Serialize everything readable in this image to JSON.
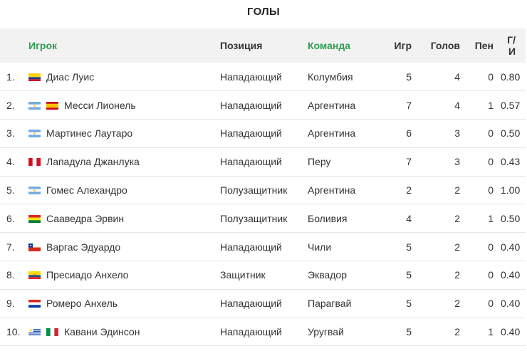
{
  "title": "ГОЛЫ",
  "headers": {
    "player": "Игрок",
    "position": "Позиция",
    "team": "Команда",
    "games": "Игр",
    "goals": "Голов",
    "penalties": "Пен",
    "ratio": "Г/И"
  },
  "rows": [
    {
      "rank": "1.",
      "flags": [
        "colombia-flag-icon"
      ],
      "player": "Диас Луис",
      "position": "Нападающий",
      "team": "Колумбия",
      "games": "5",
      "goals": "4",
      "penalties": "0",
      "ratio": "0.80"
    },
    {
      "rank": "2.",
      "flags": [
        "argentina-flag-icon",
        "spain-flag-icon"
      ],
      "player": "Месси Лионель",
      "position": "Нападающий",
      "team": "Аргентина",
      "games": "7",
      "goals": "4",
      "penalties": "1",
      "ratio": "0.57"
    },
    {
      "rank": "3.",
      "flags": [
        "argentina-flag-icon"
      ],
      "player": "Мартинес Лаутаро",
      "position": "Нападающий",
      "team": "Аргентина",
      "games": "6",
      "goals": "3",
      "penalties": "0",
      "ratio": "0.50"
    },
    {
      "rank": "4.",
      "flags": [
        "peru-flag-icon"
      ],
      "player": "Лападула Джанлука",
      "position": "Нападающий",
      "team": "Перу",
      "games": "7",
      "goals": "3",
      "penalties": "0",
      "ratio": "0.43"
    },
    {
      "rank": "5.",
      "flags": [
        "argentina-flag-icon"
      ],
      "player": "Гомес Алехандро",
      "position": "Полузащитник",
      "team": "Аргентина",
      "games": "2",
      "goals": "2",
      "penalties": "0",
      "ratio": "1.00"
    },
    {
      "rank": "6.",
      "flags": [
        "bolivia-flag-icon"
      ],
      "player": "Сааведра Эрвин",
      "position": "Полузащитник",
      "team": "Боливия",
      "games": "4",
      "goals": "2",
      "penalties": "1",
      "ratio": "0.50"
    },
    {
      "rank": "7.",
      "flags": [
        "chile-flag-icon"
      ],
      "player": "Варгас Эдуардо",
      "position": "Нападающий",
      "team": "Чили",
      "games": "5",
      "goals": "2",
      "penalties": "0",
      "ratio": "0.40"
    },
    {
      "rank": "8.",
      "flags": [
        "ecuador-flag-icon"
      ],
      "player": "Пресиадо Анхело",
      "position": "Защитник",
      "team": "Эквадор",
      "games": "5",
      "goals": "2",
      "penalties": "0",
      "ratio": "0.40"
    },
    {
      "rank": "9.",
      "flags": [
        "paraguay-flag-icon"
      ],
      "player": "Ромеро Анхель",
      "position": "Нападающий",
      "team": "Парагвай",
      "games": "5",
      "goals": "2",
      "penalties": "0",
      "ratio": "0.40"
    },
    {
      "rank": "10.",
      "flags": [
        "uruguay-flag-icon",
        "italy-flag-icon"
      ],
      "player": "Кавани Эдинсон",
      "position": "Нападающий",
      "team": "Уругвай",
      "games": "5",
      "goals": "2",
      "penalties": "1",
      "ratio": "0.40"
    }
  ]
}
